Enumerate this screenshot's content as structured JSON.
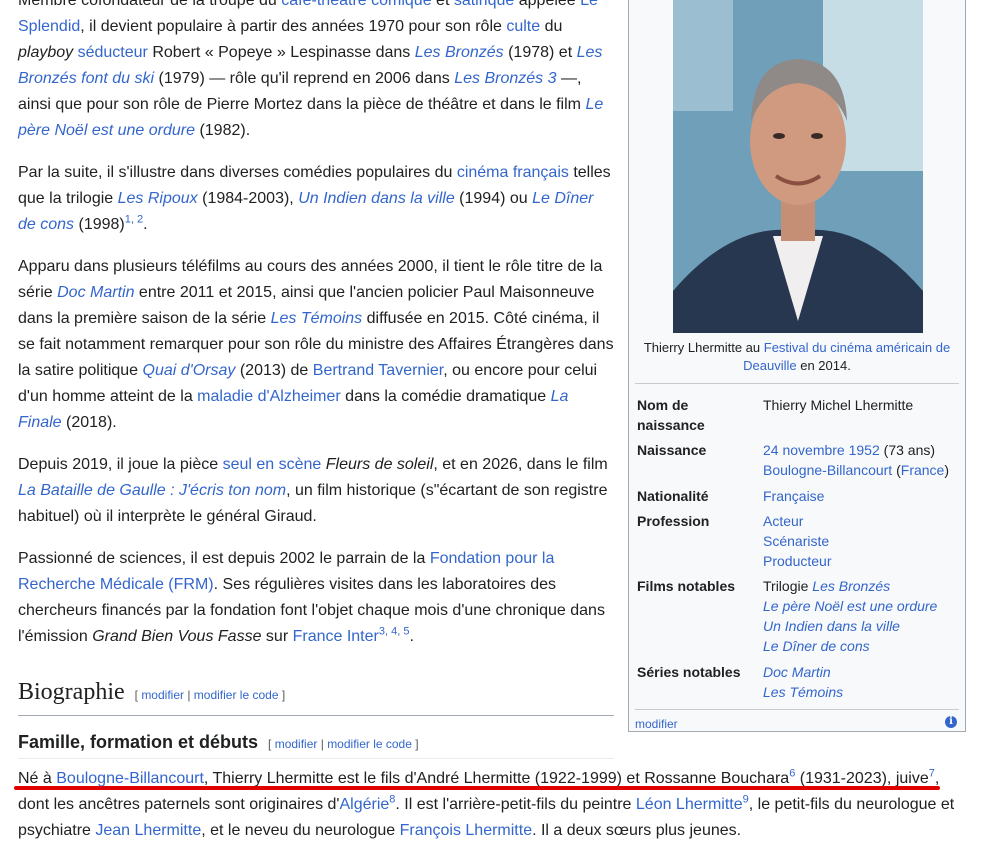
{
  "article": {
    "p0": {
      "l0a": "Membre cofondateur de la troupe du ",
      "l0b": "café-théâtre comique",
      "l0c": " et ",
      "l0d": "satirique",
      "l0e": " appelée ",
      "l0f": "Le",
      "l1a": "Splendid",
      "l1b": ", il devient populaire à partir des années 1970 pour son rôle ",
      "l1c": "culte",
      "l1d": " du",
      "l2a": "playboy",
      "l2b": " ",
      "l2c": "séducteur",
      "l2d": " Robert « Popeye » Lespinasse dans ",
      "l2e": "Les Bronzés",
      "l2f": " (1978) et ",
      "l2g": "Les",
      "l3a": "Bronzés font du ski",
      "l3b": " (1979) — rôle qu'il reprend en 2006 dans ",
      "l3c": "Les Bronzés 3",
      "l3d": " —,",
      "l4a": "ainsi que pour son rôle de Pierre Mortez dans la pièce de théâtre et dans le film ",
      "l4b": "Le",
      "l5a": "père Noël est une ordure",
      "l5b": " (1982)."
    },
    "p1": {
      "a": "Par la suite, il s'illustre dans diverses comédies populaires du ",
      "b": "cinéma français",
      "c": " telles que la trilogie ",
      "d": "Les Ripoux",
      "e": " (1984-2003), ",
      "f": "Un Indien dans la ville",
      "g": " (1994) ou ",
      "h": "Le Dîner de cons",
      "i": " (1998)",
      "s": "1, 2",
      "j": "."
    },
    "p2": {
      "a": "Apparu dans plusieurs téléfilms au cours des années 2000, il tient le rôle titre de la série ",
      "b": "Doc Martin",
      "c": " entre 2011 et 2015, ainsi que l'ancien policier Paul Maisonneuve dans la première saison de la série ",
      "d": "Les Témoins",
      "e": " diffusée en 2015. Côté cinéma, il se fait notamment remarquer pour son rôle du ministre des Affaires Étrangères dans la satire politique ",
      "f": "Quai d'Orsay",
      "g": " (2013) de ",
      "h": "Bertrand Tavernier",
      "i": ", ou encore pour celui d'un homme atteint de la ",
      "j": "maladie d'Alzheimer",
      "k": " dans la comédie dramatique ",
      "l": "La Finale",
      "m": " (2018)."
    },
    "p3": {
      "a": "Depuis 2019, il joue la pièce ",
      "b": "seul en scène",
      "c": " ",
      "d": "Fleurs de soleil",
      "e": ", et en 2026, dans le film ",
      "f": "La Bataille de Gaulle : J'écris ton nom",
      "g": ", un film historique (s\"écartant de son registre habituel) où il interprète le général Giraud."
    },
    "p4": {
      "a": "Passionné de sciences, il est depuis 2002 le parrain de la ",
      "b": "Fondation pour la Recherche Médicale (FRM)",
      "c": ". Ses régulières visites dans les laboratoires des chercheurs financés par la fondation font l'objet chaque mois d'une chronique dans l'émission ",
      "d": "Grand Bien Vous Fasse",
      "e": " sur ",
      "f": "France Inter",
      "s": "3, 4, 5",
      "g": "."
    },
    "h2": "Biographie",
    "h3": "Famille, formation et débuts",
    "edit": "modifier",
    "edit_code": "modifier le code",
    "p5": {
      "a": "Né à ",
      "b": "Boulogne-Billancourt",
      "c": ", Thierry Lhermitte est le fils d'André Lhermitte (1922-1999) et Rossanne Bouchara",
      "s1": "6",
      "d": " (1931-2023), juive",
      "s2": "7",
      "e": ",",
      "f": "dont les ancêtres paternels sont originaires d'",
      "g": "Algérie",
      "s3": "8",
      "h": ". Il est l'arrière-petit-fils du peintre ",
      "i": "Léon Lhermitte",
      "s4": "9",
      "j": ", le petit-fils du neurologue et psychiatre ",
      "k": "Jean Lhermitte",
      "l": ", et le neveu du neurologue ",
      "m": "François Lhermitte",
      "n": ". Il a deux sœurs plus jeunes."
    }
  },
  "infobox": {
    "caption_a": "Thierry Lhermitte au ",
    "caption_b": "Festival du cinéma américain de Deauville",
    "caption_c": " en 2014.",
    "rows": {
      "nom_label": "Nom de naissance",
      "nom_val": "Thierry Michel Lhermitte",
      "naiss_label": "Naissance",
      "naiss_date": "24 novembre 1952",
      "naiss_age": " (73 ans)",
      "naiss_place": "Boulogne-Billancourt",
      "naiss_country": "France",
      "nat_label": "Nationalité",
      "nat_val": "Française",
      "prof_label": "Profession",
      "prof_1": "Acteur",
      "prof_2": "Scénariste",
      "prof_3": "Producteur",
      "films_label": "Films notables",
      "films_1a": "Trilogie ",
      "films_1b": "Les Bronzés",
      "films_2": "Le père Noël est une ordure",
      "films_3": "Un Indien dans la ville",
      "films_4": "Le Dîner de cons",
      "series_label": "Séries notables",
      "series_1": "Doc Martin",
      "series_2": "Les Témoins"
    },
    "footer_edit": "modifier",
    "info_icon_glyph": "i"
  }
}
